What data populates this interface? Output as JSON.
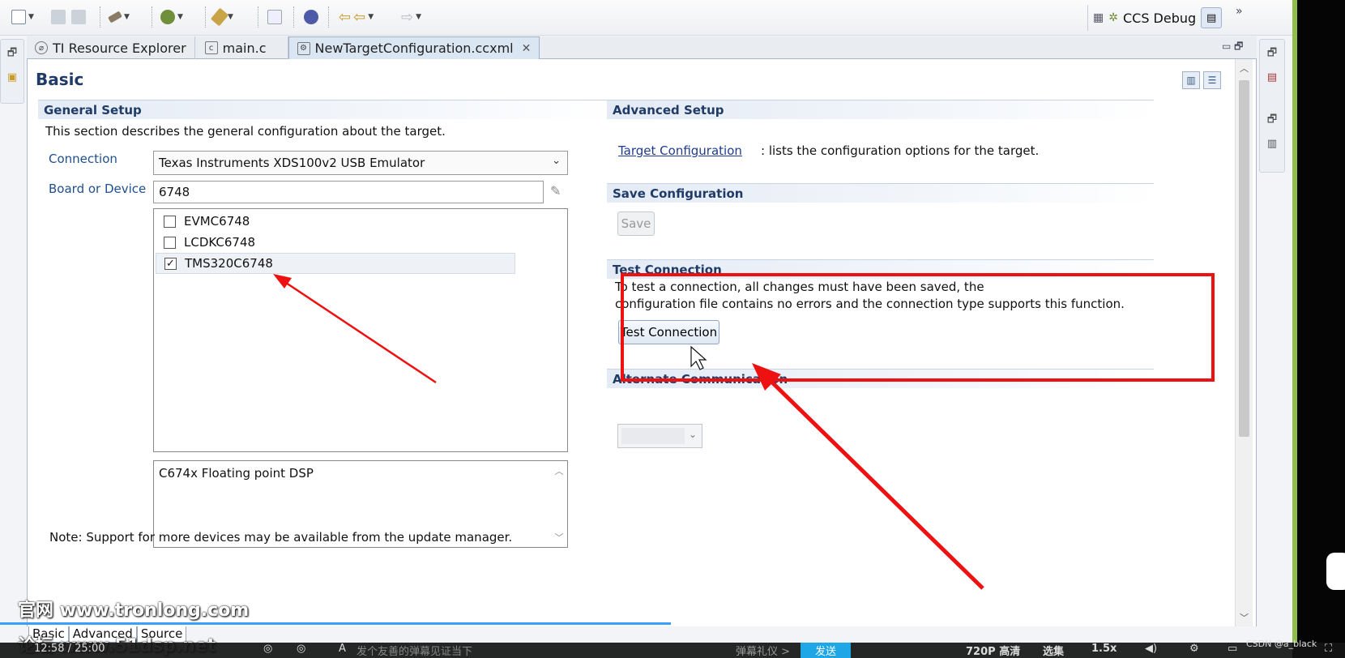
{
  "window": {
    "perspective_label": "CCS Debug"
  },
  "toolbar": {
    "icons": [
      "new-icon",
      "save-icon",
      "save-all-icon",
      "build-icon",
      "debug-icon",
      "tools-icon",
      "terminal-icon",
      "globe-icon",
      "back-icon",
      "forward-icon"
    ]
  },
  "tabs": [
    {
      "label": "TI Resource Explorer"
    },
    {
      "label": "main.c"
    },
    {
      "label": "NewTargetConfiguration.ccxml"
    }
  ],
  "editor": {
    "title": "Basic",
    "general": {
      "header": "General Setup",
      "description": "This section describes the general configuration about the target.",
      "connection_label": "Connection",
      "connection_value": "Texas Instruments XDS100v2 USB Emulator",
      "board_label": "Board or Device",
      "board_value": "6748",
      "devices": [
        {
          "name": "EVMC6748",
          "checked": false
        },
        {
          "name": "LCDKC6748",
          "checked": false
        },
        {
          "name": "TMS320C6748",
          "checked": true
        }
      ],
      "device_description": "C674x Floating point DSP",
      "note": "Note: Support for more devices may be available from the update manager."
    },
    "advanced": {
      "header": "Advanced Setup",
      "link_text": "Target Configuration",
      "link_suffix": ": lists the configuration options for the target."
    },
    "save": {
      "header": "Save Configuration",
      "button": "Save"
    },
    "test": {
      "header": "Test Connection",
      "line1": "To test a connection, all changes must have been saved, the",
      "line2": "configuration file contains no errors and the connection type supports this function.",
      "button": "Test Connection"
    },
    "alternate": {
      "header": "Alternate Communication"
    }
  },
  "page_tabs": [
    "Basic",
    "Advanced",
    "Source"
  ],
  "overlay": {
    "watermark1": "官网 www.tronlong.com",
    "watermark2": "论坛 www.51dsp.net",
    "video_time": "12:58 / 25:00",
    "danmaku_placeholder": "发个友善的弹幕见证当下",
    "danmaku_etiquette": "弹幕礼仪 >",
    "send_label": "发送",
    "quality": "720P 高清",
    "episodes": "选集",
    "speed": "1.5x",
    "credit": "CSDN @a_black"
  },
  "annotations": {
    "highlight_color": "#ee1111"
  }
}
